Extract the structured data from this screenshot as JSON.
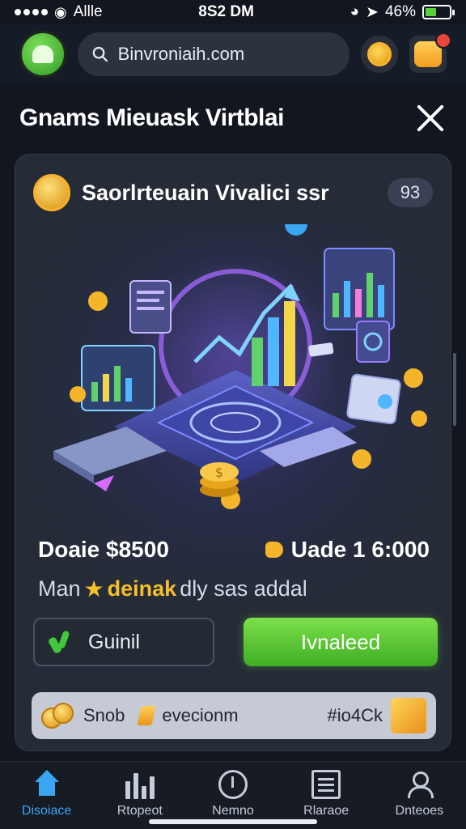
{
  "status_bar": {
    "carrier": "Allle",
    "time": "8S2 DM",
    "battery": "46%",
    "battery_level": 0.46
  },
  "header": {
    "search_value": "Binvroniaih.com",
    "logo_icon": "green-cat-logo",
    "coin_icon": "gold-coin-icon",
    "notification_icon": "gift-box-icon"
  },
  "page": {
    "title": "Gnams Mieuask Virtblai"
  },
  "card": {
    "title": "Saorlrteuain Vivalici ssr",
    "count": "93",
    "price_left": "Doaie $8500",
    "price_right": "Uade 1 6:000",
    "subline_before": "Man",
    "subline_highlight": "deinak",
    "subline_after": "dly sas addal",
    "secondary_button": "Guinil",
    "primary_button": "Ivnaleed",
    "promo_label_1": "Snob",
    "promo_label_2": "evecionm",
    "promo_code": "#io4Ck"
  },
  "nav": {
    "items": [
      {
        "label": "Disoiace",
        "icon": "home-icon"
      },
      {
        "label": "Rtopeot",
        "icon": "bars-icon"
      },
      {
        "label": "Nemno",
        "icon": "clock-icon"
      },
      {
        "label": "Rlaraoe",
        "icon": "document-icon"
      },
      {
        "label": "Dnteoes",
        "icon": "user-icon"
      }
    ]
  },
  "colors": {
    "background": "#11161f",
    "card": "#262c37",
    "accent_green": "#5fcb38",
    "accent_blue": "#3aa6f2",
    "gold": "#f5c02a"
  }
}
